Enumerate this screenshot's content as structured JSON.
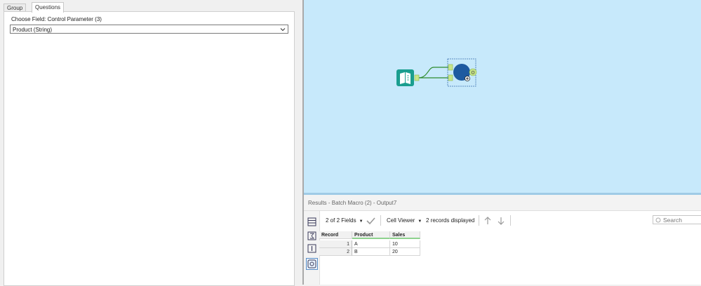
{
  "config_panel": {
    "tabs": [
      {
        "label": "Group By",
        "active": false
      },
      {
        "label": "Questions",
        "active": true
      }
    ],
    "field_label": "Choose Field: Control Parameter (3)",
    "field_value": "Product (String)"
  },
  "canvas": {
    "background": "#c7e9fb",
    "tools": [
      {
        "name": "Text Input",
        "icon": "book-icon",
        "color": "#1a9e8f"
      },
      {
        "name": "Batch Macro",
        "icon": "macro-circle-icon",
        "color": "#1e5aa0"
      }
    ],
    "connector_color": "#2e8b2e",
    "anchor_labels": {
      "output": "O"
    }
  },
  "results": {
    "title": "Results - Batch Macro (2) - Output7",
    "fields_selector": "2 of 2 Fields",
    "viewer_selector": "Cell Viewer",
    "records_count": "2 records displayed",
    "search_placeholder": "Search",
    "columns": [
      "Record",
      "Product",
      "Sales"
    ],
    "rows": [
      {
        "record": "1",
        "product": "A",
        "sales": "10"
      },
      {
        "record": "2",
        "product": "B",
        "sales": "20"
      }
    ]
  }
}
